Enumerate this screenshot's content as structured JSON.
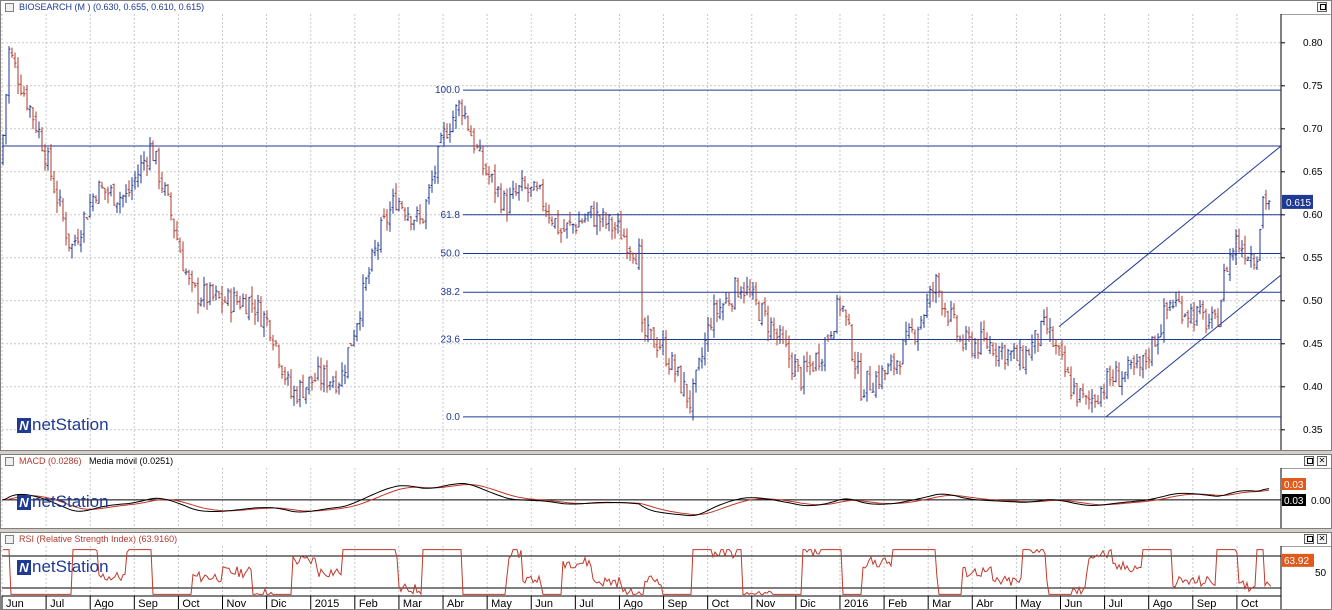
{
  "brand": {
    "logo_text": "netStation",
    "mark": "N"
  },
  "main": {
    "title_name": "BIOSEARCH (M )",
    "title_values": "(0.630, 0.655, 0.610, 0.615)",
    "price_label": "0.615",
    "colors": {
      "bar_up": "#1f3a93",
      "bar_down": "#b03a2e",
      "line": "#1f3a93",
      "label_bg": "#1f3a93"
    }
  },
  "macd_panel": {
    "title_macd": "MACD (0.0286)",
    "title_signal": "Media móvil (0.0251)",
    "macd_label": "0.03",
    "signal_label": "0.03",
    "colors": {
      "macd": "#000000",
      "signal": "#c0392b"
    }
  },
  "rsi_panel": {
    "title": "RSI (Relative Strength Index) (63.9160)",
    "value_label": "63.92",
    "color": "#c0392b"
  },
  "chart_data": [
    {
      "type": "ohlc",
      "title": "BIOSEARCH (M )",
      "x_labels": [
        "Jun",
        "Jul",
        "Ago",
        "Sep",
        "Oct",
        "Nov",
        "Dic",
        "2015",
        "Feb",
        "Mar",
        "Abr",
        "May",
        "Jun",
        "Jul",
        "Ago",
        "Sep",
        "Oct",
        "Nov",
        "Dic",
        "2016",
        "Feb",
        "Mar",
        "Abr",
        "May",
        "Jun",
        "Jul",
        "Ago",
        "Sep",
        "Oct"
      ],
      "y_ticks": [
        0.8,
        0.75,
        0.7,
        0.65,
        0.6,
        0.55,
        0.5,
        0.45,
        0.4,
        0.35
      ],
      "ylim": [
        0.33,
        0.83
      ],
      "grid": true,
      "last_value": 0.615,
      "anchors": [
        [
          0,
          0.66
        ],
        [
          8,
          0.79
        ],
        [
          40,
          0.69
        ],
        [
          70,
          0.56
        ],
        [
          95,
          0.63
        ],
        [
          125,
          0.62
        ],
        [
          150,
          0.68
        ],
        [
          170,
          0.6
        ],
        [
          190,
          0.51
        ],
        [
          220,
          0.5
        ],
        [
          250,
          0.5
        ],
        [
          270,
          0.47
        ],
        [
          290,
          0.39
        ],
        [
          315,
          0.41
        ],
        [
          340,
          0.41
        ],
        [
          365,
          0.52
        ],
        [
          380,
          0.58
        ],
        [
          395,
          0.62
        ],
        [
          420,
          0.59
        ],
        [
          445,
          0.7
        ],
        [
          460,
          0.73
        ],
        [
          480,
          0.66
        ],
        [
          505,
          0.61
        ],
        [
          520,
          0.63
        ],
        [
          540,
          0.62
        ],
        [
          560,
          0.58
        ],
        [
          590,
          0.6
        ],
        [
          620,
          0.58
        ],
        [
          640,
          0.55
        ],
        [
          641,
          0.46
        ],
        [
          660,
          0.45
        ],
        [
          690,
          0.38
        ],
        [
          710,
          0.48
        ],
        [
          740,
          0.52
        ],
        [
          770,
          0.47
        ],
        [
          800,
          0.41
        ],
        [
          820,
          0.44
        ],
        [
          840,
          0.5
        ],
        [
          860,
          0.4
        ],
        [
          890,
          0.42
        ],
        [
          920,
          0.48
        ],
        [
          935,
          0.52
        ],
        [
          960,
          0.45
        ],
        [
          990,
          0.45
        ],
        [
          1020,
          0.43
        ],
        [
          1045,
          0.47
        ],
        [
          1070,
          0.4
        ],
        [
          1085,
          0.38
        ],
        [
          1110,
          0.41
        ],
        [
          1140,
          0.42
        ],
        [
          1170,
          0.5
        ],
        [
          1200,
          0.48
        ],
        [
          1215,
          0.47
        ],
        [
          1225,
          0.54
        ],
        [
          1235,
          0.57
        ],
        [
          1255,
          0.55
        ],
        [
          1262,
          0.62
        ],
        [
          1270,
          0.615
        ]
      ],
      "fib_levels": [
        {
          "label": "100.0",
          "value": 0.745
        },
        {
          "label": "61.8",
          "value": 0.6
        },
        {
          "label": "50.0",
          "value": 0.555
        },
        {
          "label": "38.2",
          "value": 0.51
        },
        {
          "label": "23.6",
          "value": 0.455
        },
        {
          "label": "0.0",
          "value": 0.365
        }
      ],
      "horizontal_line": 0.68,
      "channel_upper": [
        [
          1058,
          0.47
        ],
        [
          1280,
          0.68
        ]
      ],
      "channel_lower": [
        [
          1105,
          0.365
        ],
        [
          1280,
          0.53
        ]
      ]
    },
    {
      "type": "line",
      "title": "MACD (0.0286)",
      "series": [
        {
          "name": "MACD (0.0286)"
        },
        {
          "name": "Media móvil (0.0251)"
        }
      ],
      "ylim": [
        -0.07,
        0.08
      ],
      "y_ticks": [
        0.0
      ],
      "last_value": 0.0286
    },
    {
      "type": "line",
      "title": "RSI (Relative Strength Index) (63.9160)",
      "series": [
        {
          "name": "RSI (Relative Strength Index) (63.9160)"
        }
      ],
      "ylim": [
        20,
        80
      ],
      "y_ticks": [
        50
      ],
      "bands": [
        70,
        30
      ],
      "last_value": 63.916
    }
  ]
}
